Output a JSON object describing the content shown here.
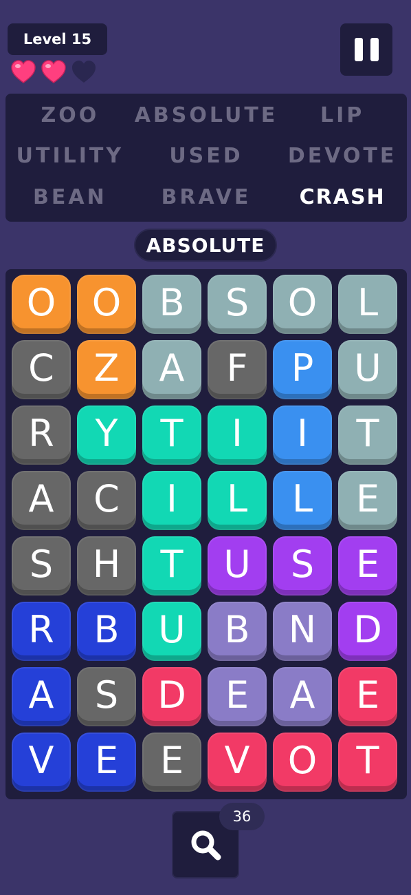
{
  "header": {
    "level_label": "Level 15",
    "lives": {
      "total": 3,
      "remaining": 2
    },
    "heart_full_color": "#ff3f7f",
    "heart_empty_color": "#2a2750",
    "pause_icon": "pause-icon"
  },
  "words": [
    {
      "text": "ZOO",
      "active": false
    },
    {
      "text": "ABSOLUTE",
      "active": false
    },
    {
      "text": "LIP",
      "active": false
    },
    {
      "text": "UTILITY",
      "active": false
    },
    {
      "text": "USED",
      "active": false
    },
    {
      "text": "DEVOTE",
      "active": false
    },
    {
      "text": "BEAN",
      "active": false
    },
    {
      "text": "BRAVE",
      "active": false
    },
    {
      "text": "CRASH",
      "active": true
    }
  ],
  "current_word": "ABSOLUTE",
  "palette": {
    "orange": "#f7932f",
    "slate": "#8fb0b3",
    "gray": "#676767",
    "blue": "#3a90f0",
    "teal": "#12d8b4",
    "purple": "#a23ef0",
    "lavender": "#8a7cc7",
    "royal": "#2540d8",
    "red": "#f23a66"
  },
  "grid": [
    [
      {
        "l": "O",
        "c": "orange"
      },
      {
        "l": "O",
        "c": "orange"
      },
      {
        "l": "B",
        "c": "slate"
      },
      {
        "l": "S",
        "c": "slate"
      },
      {
        "l": "O",
        "c": "slate"
      },
      {
        "l": "L",
        "c": "slate"
      }
    ],
    [
      {
        "l": "C",
        "c": "gray"
      },
      {
        "l": "Z",
        "c": "orange"
      },
      {
        "l": "A",
        "c": "slate"
      },
      {
        "l": "F",
        "c": "gray"
      },
      {
        "l": "P",
        "c": "blue"
      },
      {
        "l": "U",
        "c": "slate"
      }
    ],
    [
      {
        "l": "R",
        "c": "gray"
      },
      {
        "l": "Y",
        "c": "teal"
      },
      {
        "l": "T",
        "c": "teal"
      },
      {
        "l": "I",
        "c": "teal"
      },
      {
        "l": "I",
        "c": "blue"
      },
      {
        "l": "T",
        "c": "slate"
      }
    ],
    [
      {
        "l": "A",
        "c": "gray"
      },
      {
        "l": "C",
        "c": "gray"
      },
      {
        "l": "I",
        "c": "teal"
      },
      {
        "l": "L",
        "c": "teal"
      },
      {
        "l": "L",
        "c": "blue"
      },
      {
        "l": "E",
        "c": "slate"
      }
    ],
    [
      {
        "l": "S",
        "c": "gray"
      },
      {
        "l": "H",
        "c": "gray"
      },
      {
        "l": "T",
        "c": "teal"
      },
      {
        "l": "U",
        "c": "purple"
      },
      {
        "l": "S",
        "c": "purple"
      },
      {
        "l": "E",
        "c": "purple"
      }
    ],
    [
      {
        "l": "R",
        "c": "royal"
      },
      {
        "l": "B",
        "c": "royal"
      },
      {
        "l": "U",
        "c": "teal"
      },
      {
        "l": "B",
        "c": "lavender"
      },
      {
        "l": "N",
        "c": "lavender"
      },
      {
        "l": "D",
        "c": "purple"
      }
    ],
    [
      {
        "l": "A",
        "c": "royal"
      },
      {
        "l": "S",
        "c": "gray"
      },
      {
        "l": "D",
        "c": "red"
      },
      {
        "l": "E",
        "c": "lavender"
      },
      {
        "l": "A",
        "c": "lavender"
      },
      {
        "l": "E",
        "c": "red"
      }
    ],
    [
      {
        "l": "V",
        "c": "royal"
      },
      {
        "l": "E",
        "c": "royal"
      },
      {
        "l": "E",
        "c": "gray"
      },
      {
        "l": "V",
        "c": "red"
      },
      {
        "l": "O",
        "c": "red"
      },
      {
        "l": "T",
        "c": "red"
      }
    ]
  ],
  "hint": {
    "icon": "search-icon",
    "count": "36"
  }
}
